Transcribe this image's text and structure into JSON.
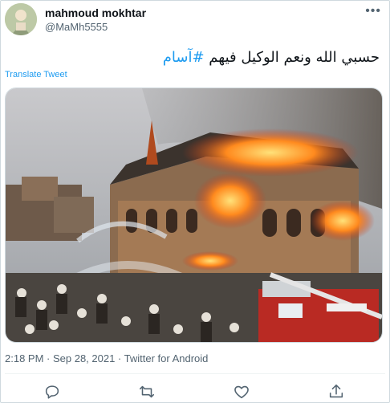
{
  "user": {
    "name": "mahmoud mokhtar",
    "handle": "@MaMh5555"
  },
  "tweet": {
    "text": "حسبي الله ونعم الوكيل فيهم ",
    "hashtag": "#آسام",
    "translate_label": "Translate Tweet",
    "meta": "2:18 PM · Sep 28, 2021 · Twitter for Android"
  },
  "icons": {
    "more": "more-icon",
    "reply": "reply-icon",
    "retweet": "retweet-icon",
    "like": "heart-icon",
    "share": "share-icon"
  },
  "colors": {
    "accent": "#1d9bf0",
    "secondary_text": "#536471",
    "border": "#cfd9de"
  }
}
